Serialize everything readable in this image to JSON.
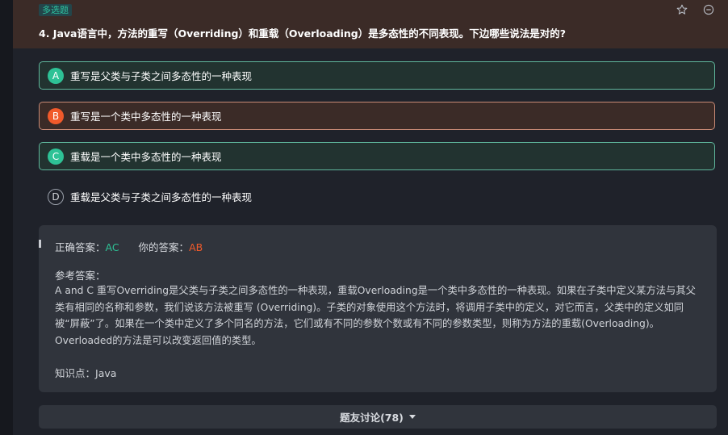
{
  "question": {
    "tag": "多选题",
    "title": "4. Java语言中，方法的重写（Overriding）和重载（Overloading）是多态性的不同表现。下边哪些说法是对的?"
  },
  "options": [
    {
      "letter": "A",
      "text": "重写是父类与子类之间多态性的一种表现",
      "state": "correct-selected"
    },
    {
      "letter": "B",
      "text": "重写是一个类中多态性的一种表现",
      "state": "wrong-selected"
    },
    {
      "letter": "C",
      "text": "重载是一个类中多态性的一种表现",
      "state": "correct-missed"
    },
    {
      "letter": "D",
      "text": "重载是父类与子类之间多态性的一种表现",
      "state": "unselected"
    }
  ],
  "answer": {
    "correct_label": "正确答案：",
    "correct_value": "AC",
    "yours_label": "你的答案：",
    "yours_value": "AB",
    "reference_label": "参考答案：",
    "reference_text": "A and C 重写Overriding是父类与子类之间多态性的一种表现，重载Overloading是一个类中多态性的一种表现。如果在子类中定义某方法与其父类有相同的名称和参数，我们说该方法被重写 (Overriding)。子类的对象使用这个方法时，将调用子类中的定义，对它而言，父类中的定义如同被“屏蔽”了。如果在一个类中定义了多个同名的方法，它们或有不同的参数个数或有不同的参数类型，则称为方法的重载(Overloading)。 Overloaded的方法是可以改变返回值的类型。",
    "knowledge_label": "知识点：",
    "knowledge_value": "Java"
  },
  "discussion": {
    "label": "题友讨论(78)"
  },
  "icons": {
    "star": "star-icon",
    "minus": "minus-circle-icon",
    "caret": "caret-down-icon"
  },
  "colors": {
    "correct": "#2ec296",
    "wrong": "#f15a2b",
    "header_bg": "#3b2b27",
    "panel_bg": "#30343c"
  }
}
